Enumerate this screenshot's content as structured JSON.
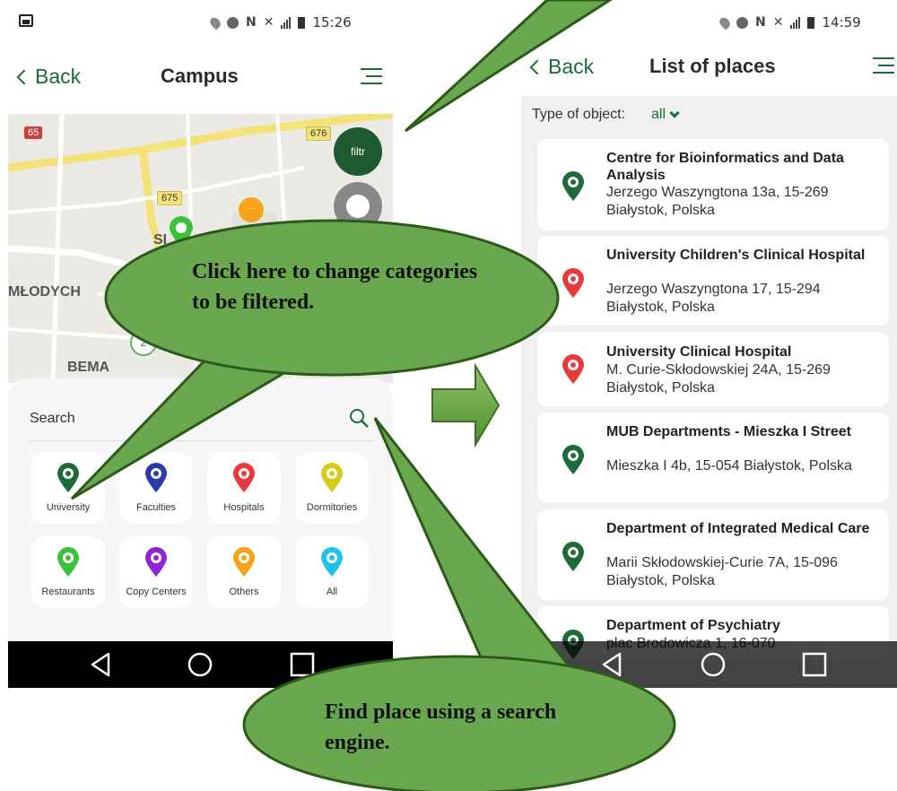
{
  "phone1": {
    "status_time": "15:26",
    "back_label": "Back",
    "title": "Campus",
    "map": {
      "labels": [
        "MŁODYCH",
        "BEMA",
        "SI"
      ],
      "road_badges": [
        "65",
        "676",
        "675"
      ],
      "cluster_count": "2",
      "filter_button_label": "filtr"
    },
    "search_label": "Search",
    "categories": [
      {
        "label": "University",
        "color": "#1e6b3a",
        "icon": "university-icon"
      },
      {
        "label": "Faculties",
        "color": "#2a3aa8",
        "icon": "faculty-icon"
      },
      {
        "label": "Hospitals",
        "color": "#e83a3a",
        "icon": "hospital-icon"
      },
      {
        "label": "Dormitories",
        "color": "#d6cc1a",
        "icon": "dormitory-icon"
      },
      {
        "label": "Restaurants",
        "color": "#3cc13c",
        "icon": "restaurant-icon"
      },
      {
        "label": "Copy Centers",
        "color": "#8e24d6",
        "icon": "printer-icon"
      },
      {
        "label": "Others",
        "color": "#f5a31a",
        "icon": "others-icon"
      },
      {
        "label": "All",
        "color": "#1ec3e8",
        "icon": "grid-icon"
      }
    ]
  },
  "phone2": {
    "status_time": "14:59",
    "back_label": "Back",
    "title": "List of places",
    "filter_label": "Type of object:",
    "filter_value": "all",
    "places": [
      {
        "name": "Centre for Bioinformatics and Data Analysis",
        "address": "Jerzego Waszyngtona 13a, 15-269 Białystok, Polska",
        "color": "#1e6b3a"
      },
      {
        "name": "University Children's Clinical Hospital",
        "address": "Jerzego Waszyngtona 17, 15-294 Białystok, Polska",
        "color": "#e83a3a"
      },
      {
        "name": "University Clinical Hospital",
        "address": "M. Curie-Skłodowskiej 24A, 15-269 Białystok, Polska",
        "color": "#e83a3a"
      },
      {
        "name": "MUB Departments - Mieszka I Street",
        "address": "Mieszka I 4b, 15-054 Białystok, Polska",
        "color": "#1e6b3a"
      },
      {
        "name": "Department of Integrated Medical Care",
        "address": "Marii Skłodowskiej-Curie 7A, 15-096 Białystok, Polska",
        "color": "#1e6b3a"
      },
      {
        "name": "Department of Psychiatry",
        "address": "plac Brodowicza 1, 16-070",
        "color": "#1e6b3a"
      }
    ]
  },
  "callouts": {
    "filter_hint": "Click here to change categories to be filtered.",
    "search_hint": "Find place using a search engine."
  },
  "colors": {
    "accent": "#1e6b3a",
    "bubble_fill": "#6aa84f",
    "bubble_stroke": "#2d5a1b"
  }
}
